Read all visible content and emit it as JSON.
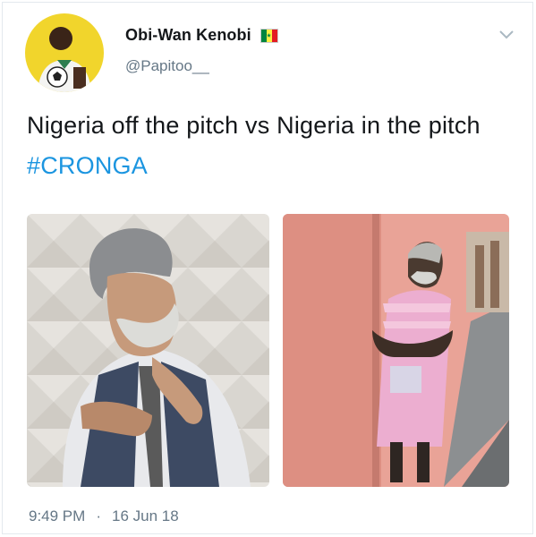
{
  "tweet": {
    "display_name": "Obi-Wan Kenobi",
    "handle": "@Papitoo__",
    "text_main": "Nigeria off the pitch vs Nigeria in the pitch ",
    "hashtag": "#CRONGA",
    "time": "9:49 PM",
    "separator": "·",
    "date": "16 Jun 18"
  },
  "colors": {
    "accent": "#1b95e0",
    "text": "#14171a",
    "muted": "#657786",
    "flag_green": "#00853f",
    "flag_yellow": "#fdef42",
    "flag_red": "#e31b23"
  },
  "icons": {
    "flag": "senegal-flag-icon",
    "menu": "chevron-down-icon"
  }
}
